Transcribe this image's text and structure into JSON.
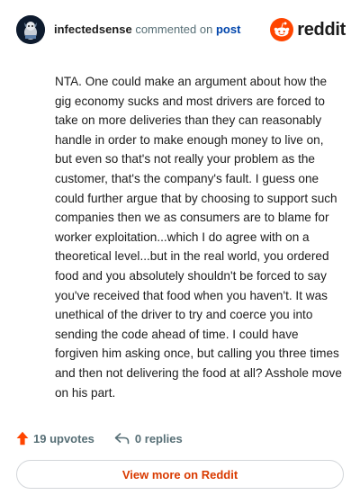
{
  "header": {
    "username": "infectedsense",
    "action": "commented on",
    "post_link": "post",
    "brand": "reddit"
  },
  "comment": {
    "text": "NTA. One could make an argument about how the gig economy sucks and most drivers are forced to take on more deliveries than they can reasonably handle in order to make enough money to live on, but even so that's not really your problem as the customer, that's the company's fault. I guess one could further argue that by choosing to support such companies then we as consumers are to blame for worker exploitation...which I do agree with on a theoretical level...but in the real world, you ordered food and you absolutely shouldn't be forced to say you've received that food when you haven't. It was unethical of the driver to try and coerce you into sending the code ahead of time. I could have forgiven him asking once, but calling you three times and then not delivering the food at all? Asshole move on his part."
  },
  "footer": {
    "upvotes": "19 upvotes",
    "replies": "0 replies",
    "upvote_icon": "upvote-arrow-icon",
    "reply_icon": "reply-arrow-icon"
  },
  "view_more_label": "View more on Reddit",
  "colors": {
    "brand_orange": "#ff4500",
    "upvote": "#ff4500",
    "link_blue": "#0045ac",
    "view_more_text": "#d93a00",
    "muted": "#576f76"
  }
}
